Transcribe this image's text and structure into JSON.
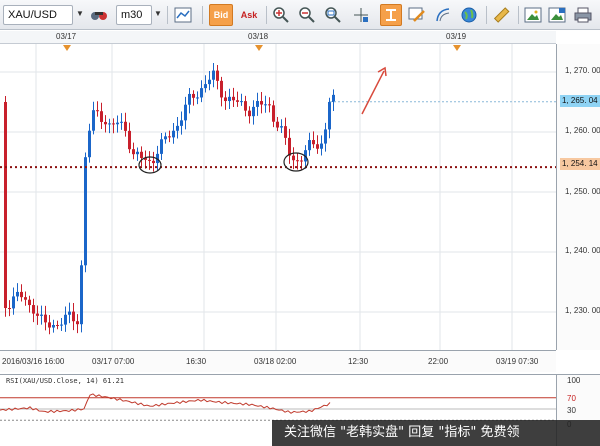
{
  "toolbar": {
    "symbol": "XAU/USD",
    "timeframe": "m30",
    "bid_label": "Bid",
    "ask_label": "Ask"
  },
  "date_markers": [
    "03/17",
    "03/18",
    "03/19"
  ],
  "price_axis": {
    "labels": [
      "1, 270. 00",
      "1, 260. 00",
      "1, 250. 00",
      "1, 240. 00",
      "1, 230. 00"
    ],
    "current_price_tag": "1, 265. 04",
    "line_price_tag": "1, 254. 14"
  },
  "time_axis": {
    "labels": [
      "2016/03/16 16:00",
      "03/17 07:00",
      "16:30",
      "03/18 02:00",
      "12:30",
      "22:00",
      "03/19 07:30"
    ]
  },
  "rsi": {
    "title": "RSI(XAU/USD.Close, 14)  61.21",
    "levels": [
      "100",
      "70",
      "30",
      "0"
    ],
    "value": 61.21
  },
  "colors": {
    "bull": "#1b66c9",
    "bear": "#c8202c",
    "support_line": "#8b1010",
    "arrow": "#d84a3c",
    "active_button": "#f5a04a",
    "rsi_line": "#c0392b"
  },
  "watermark": "关注微信 \"老韩实盘\" 回复 \"指标\" 免费领"
}
